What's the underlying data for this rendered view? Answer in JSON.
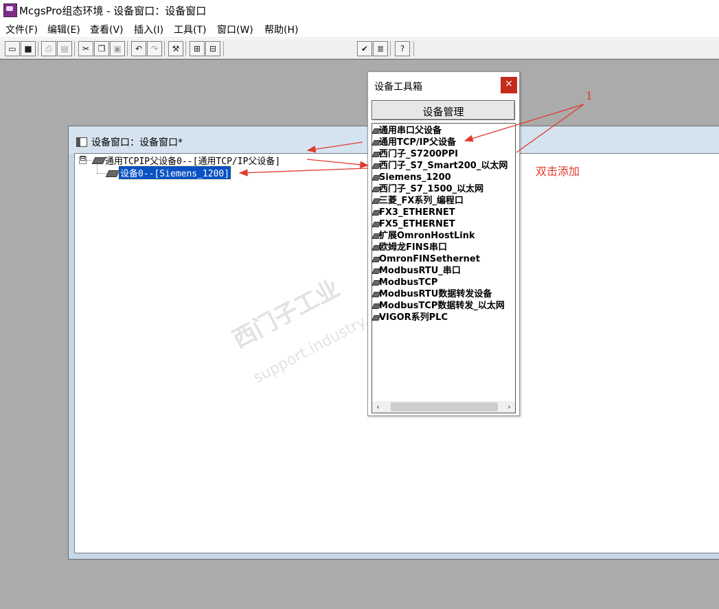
{
  "window": {
    "title": "McgsPro组态环境 - 设备窗口：设备窗口"
  },
  "menu": [
    "文件(F)",
    "编辑(E)",
    "查看(V)",
    "插入(I)",
    "工具(T)",
    "窗口(W)",
    "帮助(H)"
  ],
  "toolbar": {
    "buttons": [
      "new-window-icon",
      "save-icon",
      "print-icon",
      "print-preview-icon",
      "cut-icon",
      "copy-icon",
      "paste-icon",
      "undo-icon",
      "redo-icon",
      "tools-icon",
      "tree-expand-icon",
      "tree-collapse-icon",
      "check-icon",
      "list-icon",
      "help-icon"
    ]
  },
  "device_window": {
    "title": "设备窗口：设备窗口*",
    "tree": {
      "parent": "通用TCPIP父设备0--[通用TCP/IP父设备]",
      "child": "设备0--[Siemens_1200]",
      "expander": "⊟"
    }
  },
  "toolbox": {
    "title": "设备工具箱",
    "close": "×",
    "manage_button": "设备管理",
    "items": [
      "通用串口父设备",
      "通用TCP/IP父设备",
      "西门子_S7200PPI",
      "西门子_S7_Smart200_以太网",
      "Siemens_1200",
      "西门子_S7_1500_以太网",
      "三菱_FX系列_编程口",
      "FX3_ETHERNET",
      "FX5_ETHERNET",
      "扩展OmronHostLink",
      "欧姆龙FINS串口",
      "OmronFINSethernet",
      "ModbusRTU_串口",
      "ModbusTCP",
      "ModbusRTU数据转发设备",
      "ModbusTCP数据转发_以太网",
      "VIGOR系列PLC"
    ],
    "scroll_left": "‹",
    "scroll_right": "›"
  },
  "annotations": {
    "label_1": "1",
    "double_click_hint": "双击添加",
    "color": "#e0392b"
  },
  "watermark": {
    "line1": "西门子工业",
    "line2": "support.industry.siemens"
  }
}
